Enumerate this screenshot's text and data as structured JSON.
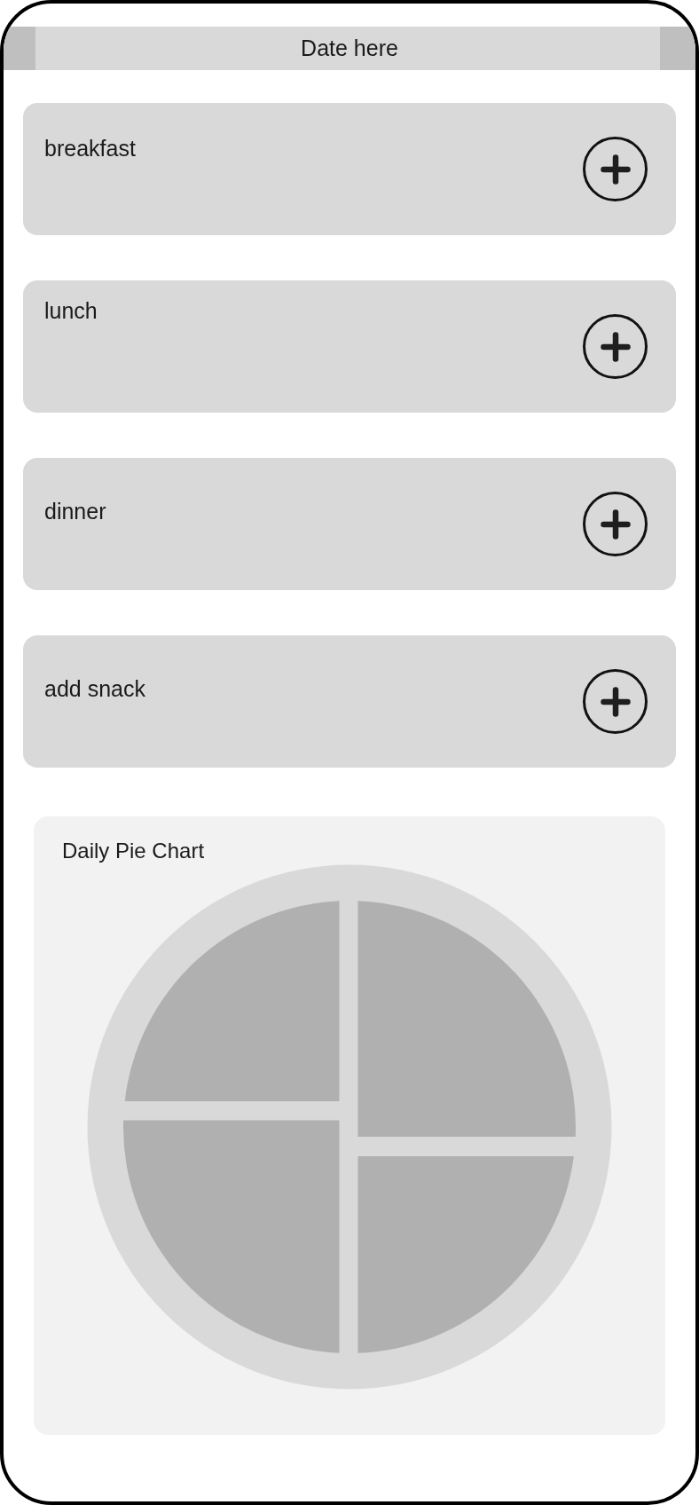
{
  "header": {
    "date": "Date here"
  },
  "meals": [
    {
      "label": "breakfast"
    },
    {
      "label": "lunch"
    },
    {
      "label": "dinner"
    },
    {
      "label": "add snack"
    }
  ],
  "pie_panel": {
    "title": "Daily Pie Chart"
  }
}
